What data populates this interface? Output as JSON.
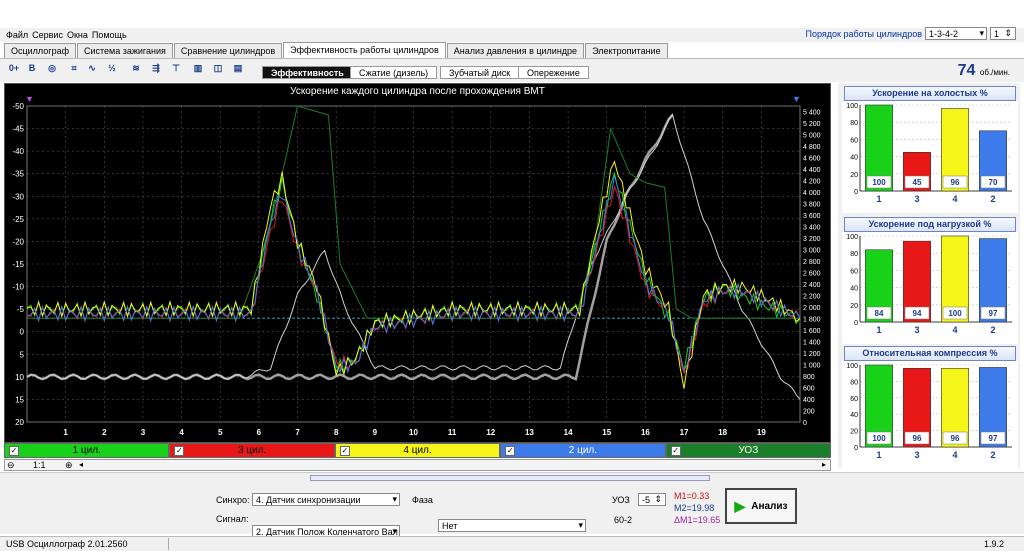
{
  "menu": [
    "Файл",
    "Сервис",
    "Окна",
    "Помощь"
  ],
  "cylinder_order": {
    "label": "Порядок работы цилиндров",
    "value": "1-3-4-2",
    "spin": "1"
  },
  "tabs": [
    "Осциллограф",
    "Система зажигания",
    "Сравнение цилиндров",
    "Эффективность работы цилиндров",
    "Анализ давления в цилиндре",
    "Электропитание"
  ],
  "active_tab_index": 3,
  "subtabs": [
    "Эффективность",
    "Сжатие (дизель)",
    "Зубчатый диск",
    "Опережение"
  ],
  "rpm": {
    "value": "74",
    "unit": "об./мин."
  },
  "chart_title": "Ускорение каждого цилиндра после прохождения ВМТ",
  "legend": [
    {
      "label": "1 цил.",
      "color": "#19d119",
      "text_color": "#000"
    },
    {
      "label": "3 цил.",
      "color": "#e81818",
      "text_color": "#000"
    },
    {
      "label": "4 цил.",
      "color": "#f5f51a",
      "text_color": "#000"
    },
    {
      "label": "2 цил.",
      "color": "#3d7bea",
      "text_color": "#fff"
    },
    {
      "label": "УОЗ",
      "color": "#1b7e2a",
      "text_color": "#fff"
    }
  ],
  "zoom": "1:1",
  "chart_data": [
    {
      "type": "line",
      "title": "Ускорение каждого цилиндра после прохождения ВМТ",
      "x_ticks": [
        "1",
        "2",
        "3",
        "4",
        "5",
        "6",
        "7",
        "8",
        "9",
        "10",
        "11",
        "12",
        "13",
        "14",
        "15",
        "16",
        "17",
        "18",
        "19"
      ],
      "y_left_ticks": [
        "-50",
        "-45",
        "-40",
        "-35",
        "-30",
        "-25",
        "-20",
        "-15",
        "-10",
        "-5",
        "0",
        "5",
        "10",
        "15",
        "20"
      ],
      "y_right_ticks": [
        "5 400",
        "5 200",
        "5 000",
        "4 800",
        "4 600",
        "4 400",
        "4 200",
        "4 000",
        "3 800",
        "3 600",
        "3 400",
        "3 200",
        "3 000",
        "2 800",
        "2 600",
        "2 400",
        "2 200",
        "2 000",
        "1 800",
        "1 600",
        "1 400",
        "1 200",
        "1 000",
        "800",
        "600",
        "400",
        "200",
        "0"
      ],
      "ylim_left": [
        20,
        -50
      ],
      "ylim_right": [
        0,
        5500
      ],
      "grid": true,
      "series": [
        {
          "name": "1 цил.",
          "color": "#19d119",
          "x": [
            0,
            3,
            5.8,
            6.3,
            6.6,
            7,
            7.5,
            8,
            8.5,
            9,
            11,
            13,
            14.3,
            14.8,
            15.2,
            16,
            16.6,
            17,
            17.5,
            18,
            18.5,
            19,
            20
          ],
          "y": [
            -5,
            -5,
            -5,
            -25,
            -33,
            -20,
            -8,
            8,
            6,
            -2,
            -5,
            -5,
            -5,
            -22,
            -35,
            -12,
            -3,
            8,
            -7,
            -10,
            -8,
            -6,
            -3
          ]
        },
        {
          "name": "3 цил.",
          "color": "#e81818",
          "x": [
            0,
            3,
            5.8,
            6.3,
            6.6,
            7,
            7.5,
            8,
            8.5,
            9,
            11,
            13,
            14.3,
            14.8,
            15.2,
            16,
            16.6,
            17,
            17.5,
            18,
            18.5,
            19,
            20
          ],
          "y": [
            -4,
            -4,
            -4,
            -22,
            -30,
            -18,
            -9,
            7,
            7,
            -1,
            -4,
            -4,
            -4,
            -20,
            -32,
            -10,
            -4,
            10,
            -6,
            -9,
            -9,
            -7,
            -3
          ]
        },
        {
          "name": "4 цил.",
          "color": "#f5f51a",
          "x": [
            0,
            3,
            5.8,
            6.3,
            6.6,
            7,
            7.5,
            8,
            8.5,
            9,
            11,
            13,
            14.3,
            14.8,
            15.2,
            16,
            16.6,
            17,
            17.5,
            18,
            18.5,
            19,
            20
          ],
          "y": [
            -5,
            -5,
            -5,
            -28,
            -34,
            -20,
            -10,
            9,
            6,
            -2,
            -5,
            -5,
            -5,
            -25,
            -38,
            -14,
            -5,
            12,
            -8,
            -10,
            -10,
            -8,
            -3
          ]
        },
        {
          "name": "2 цил.",
          "color": "#3d7bea",
          "x": [
            0,
            3,
            5.8,
            6.3,
            6.6,
            7,
            7.5,
            8,
            8.5,
            9,
            11,
            13,
            14.3,
            14.8,
            15.2,
            16,
            16.6,
            17,
            17.5,
            18,
            18.5,
            19,
            20
          ],
          "y": [
            -4,
            -4,
            -4,
            -24,
            -31,
            -19,
            -9,
            8,
            7,
            -1,
            -4,
            -4,
            -4,
            -21,
            -34,
            -11,
            -4,
            9,
            -7,
            -9,
            -9,
            -7,
            -3
          ]
        },
        {
          "name": "УОЗ",
          "color": "#1b7e2a",
          "x": [
            0,
            5.5,
            6.2,
            7,
            7.8,
            8.1,
            8.8,
            14.2,
            14.7,
            15.1,
            15.6,
            16,
            16.5,
            16.8,
            17.2,
            19,
            20
          ],
          "y": [
            -3,
            -3,
            -20,
            -50,
            -48,
            -15,
            -3,
            -3,
            -20,
            -45,
            -35,
            -33,
            -32,
            -5,
            -3,
            -3,
            -3
          ]
        },
        {
          "name": "",
          "color": "#cfcfcf",
          "x": [
            0,
            5.6,
            6.3,
            7,
            7.7,
            8.2,
            9,
            13.8,
            14.6,
            15.5,
            16.2,
            16.7,
            17.5,
            18.5,
            19.5,
            20
          ],
          "y": [
            10,
            10,
            8,
            -8,
            -18,
            -6,
            8,
            8,
            -15,
            -30,
            -40,
            -48,
            -25,
            -5,
            10,
            15
          ]
        },
        {
          "name": "",
          "color": "#a0a0a0",
          "x": [
            0,
            5.6,
            14.2,
            14.6,
            15,
            15.5,
            16,
            16.5,
            16.7
          ],
          "y": [
            10,
            10,
            10,
            -5,
            -20,
            -30,
            -38,
            -45,
            -48
          ]
        }
      ]
    },
    {
      "type": "bar",
      "title": "Ускорение на холостых %",
      "categories": [
        "1",
        "3",
        "4",
        "2"
      ],
      "values": [
        100,
        45,
        96,
        70
      ],
      "ylim": [
        0,
        100
      ]
    },
    {
      "type": "bar",
      "title": "Ускорение под нагрузкой %",
      "categories": [
        "1",
        "3",
        "4",
        "2"
      ],
      "values": [
        84,
        94,
        100,
        97
      ],
      "ylim": [
        0,
        100
      ]
    },
    {
      "type": "bar",
      "title": "Относительная компрессия %",
      "categories": [
        "1",
        "3",
        "4",
        "2"
      ],
      "values": [
        100,
        96,
        96,
        97
      ],
      "ylim": [
        0,
        100
      ]
    }
  ],
  "bar_colors": [
    "#19d119",
    "#e81818",
    "#f5f51a",
    "#3d7bea"
  ],
  "bottom": {
    "sync_label": "Синхро:",
    "sync_value": "4. Датчик синхронизации",
    "signal_label": "Сигнал:",
    "signal_value": "2. Датчик Полож Коленчатого Вал",
    "phase_label": "Фаза",
    "phase_value": "Нет",
    "uoz_label": "УОЗ",
    "uoz_value": "-5",
    "gear": "60-2",
    "m1": "M1=0.33",
    "m2": "M2=19.98",
    "dm": "ΔM1=19.65",
    "analyze": "Анализ"
  },
  "status": {
    "app": "USB Осциллограф  2.01.2560",
    "version": "1.9.2"
  }
}
